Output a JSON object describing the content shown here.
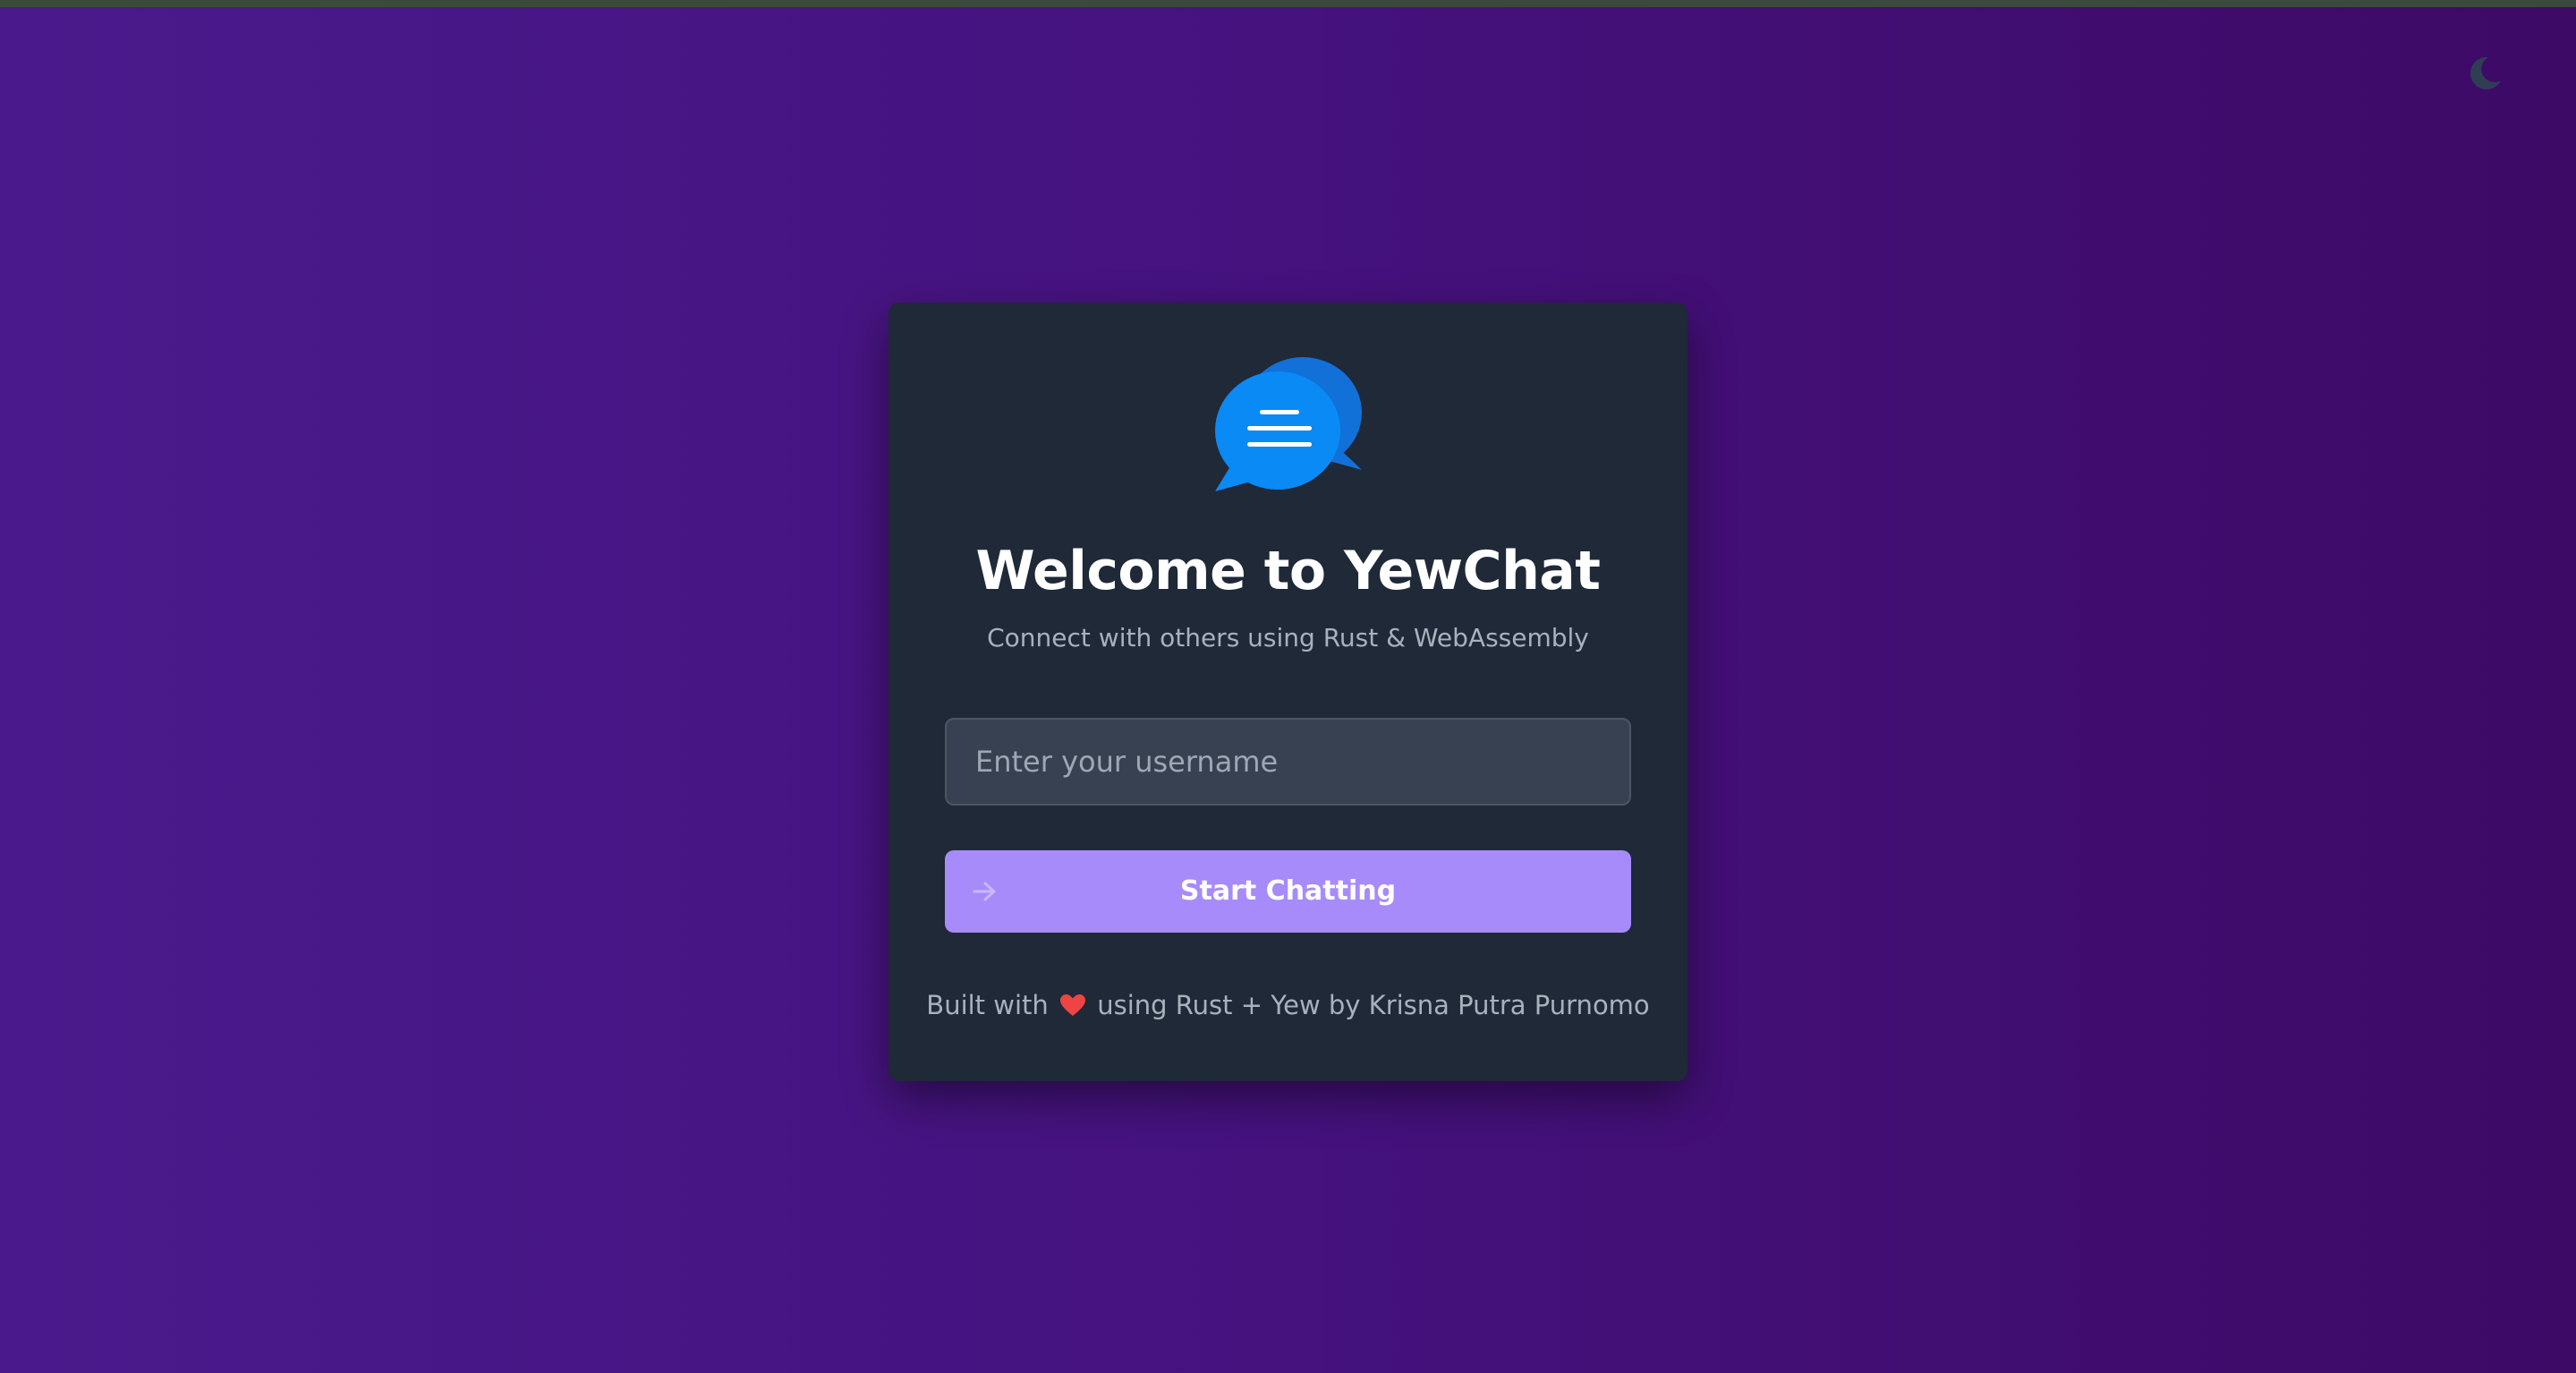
{
  "theme_toggle": {
    "icon": "moon-icon",
    "color": "#2f3e52"
  },
  "card": {
    "logo_icon": "chat-bubbles-icon",
    "title": "Welcome to YewChat",
    "subtitle": "Connect with others using Rust & WebAssembly",
    "username_input": {
      "value": "",
      "placeholder": "Enter your username"
    },
    "start_button": {
      "label": "Start Chatting",
      "icon": "arrow-right-icon",
      "color": "#a78bfa"
    },
    "footer": {
      "prefix": "Built with",
      "heart_icon": "heart-icon",
      "suffix": "using Rust + Yew by Krisna Putra Purnomo"
    }
  },
  "colors": {
    "background_start": "#4a1a8c",
    "background_end": "#3d0a66",
    "card_background": "#1f2937",
    "accent": "#a78bfa",
    "logo_blue": "#0a8af4",
    "heart": "#ef4444"
  }
}
